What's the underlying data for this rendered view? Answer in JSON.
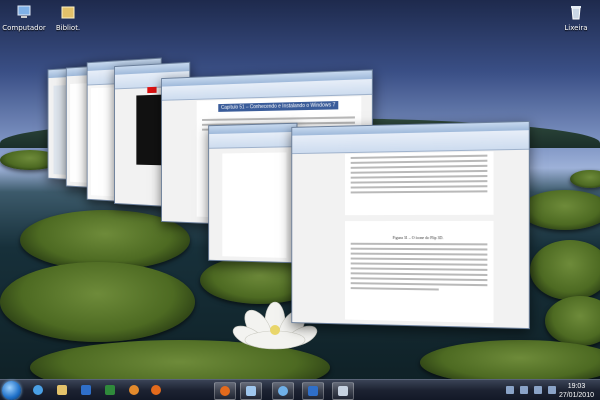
{
  "desktop": {
    "icons": [
      {
        "label": "Computador",
        "icon": "computer-icon"
      },
      {
        "label": "Bibliot.",
        "icon": "folder-icon"
      },
      {
        "label": "Lixeira",
        "icon": "recycle-bin-icon"
      }
    ]
  },
  "flip3d": {
    "windows": [
      {
        "name": "window-1",
        "kind": "word-document"
      },
      {
        "name": "window-2",
        "kind": "word-document"
      },
      {
        "name": "window-3",
        "kind": "word-document"
      },
      {
        "name": "window-4",
        "kind": "browser"
      },
      {
        "name": "window-5",
        "kind": "explorer"
      },
      {
        "name": "window-6",
        "kind": "explorer"
      }
    ],
    "front_document_caption": "Figura 31 – O ícone do Flip 3D.",
    "back_document_heading": "Capítulo 51 – Conhecendo e Instalando o Windows 7"
  },
  "taskbar": {
    "pinned": [
      {
        "icon": "internet-explorer-icon",
        "color": "#4aa0e6"
      },
      {
        "icon": "windows-explorer-icon",
        "color": "#e3c26a"
      },
      {
        "icon": "word-icon",
        "color": "#2f6fc9"
      },
      {
        "icon": "excel-icon",
        "color": "#2f8a3b"
      },
      {
        "icon": "media-player-icon",
        "color": "#e38a2c"
      },
      {
        "icon": "firefox-icon",
        "color": "#e36a1c"
      }
    ],
    "open": [
      {
        "icon": "firefox-window-icon",
        "color": "#e36a1c"
      },
      {
        "icon": "paint-window-icon",
        "color": "#9fc7ee"
      },
      {
        "icon": "explorer-window-icon",
        "color": "#6fb0e8"
      },
      {
        "icon": "word-window-icon",
        "color": "#2f6fc9"
      },
      {
        "icon": "document-window-icon",
        "color": "#c7d2e0"
      }
    ],
    "clock_time": "19:03",
    "clock_date": "27/01/2010"
  }
}
